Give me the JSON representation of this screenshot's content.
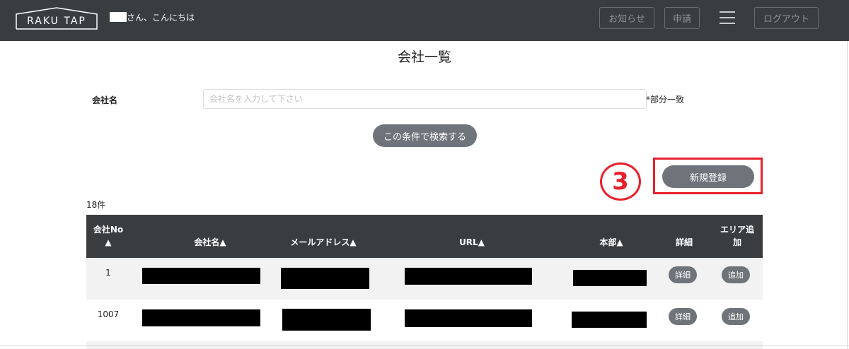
{
  "header": {
    "logo_text": "RAKU TAP",
    "greeting": "さん、こんにちは",
    "notice_label": "お知らせ",
    "apply_label": "申請",
    "logout_label": "ログアウト"
  },
  "page": {
    "title": "会社一覧"
  },
  "search": {
    "company_label": "会社名",
    "placeholder": "会社名を入力して下さい",
    "value": "",
    "partial_match_note": "*部分一致",
    "submit_label": "この条件で検索する"
  },
  "annotation": {
    "step_number": "3"
  },
  "actions": {
    "new_register_label": "新規登録"
  },
  "results": {
    "count_text": "18件"
  },
  "table": {
    "headers": {
      "no_line1": "会社No",
      "no_line2": "▲",
      "name": "会社名▲",
      "email": "メールアドレス▲",
      "url": "URL▲",
      "hq": "本部▲",
      "detail": "詳細",
      "area_add_line1": "エリア追",
      "area_add_line2": "加"
    },
    "rows": [
      {
        "no": "1",
        "detail_label": "詳細",
        "add_label": "追加"
      },
      {
        "no": "1007",
        "detail_label": "詳細",
        "add_label": "追加"
      }
    ]
  },
  "colors": {
    "header_bg": "#3a3d40",
    "button_bg": "#6e747a",
    "annotation_red": "#e8202a",
    "row_alt_bg": "#f2f2f2"
  }
}
